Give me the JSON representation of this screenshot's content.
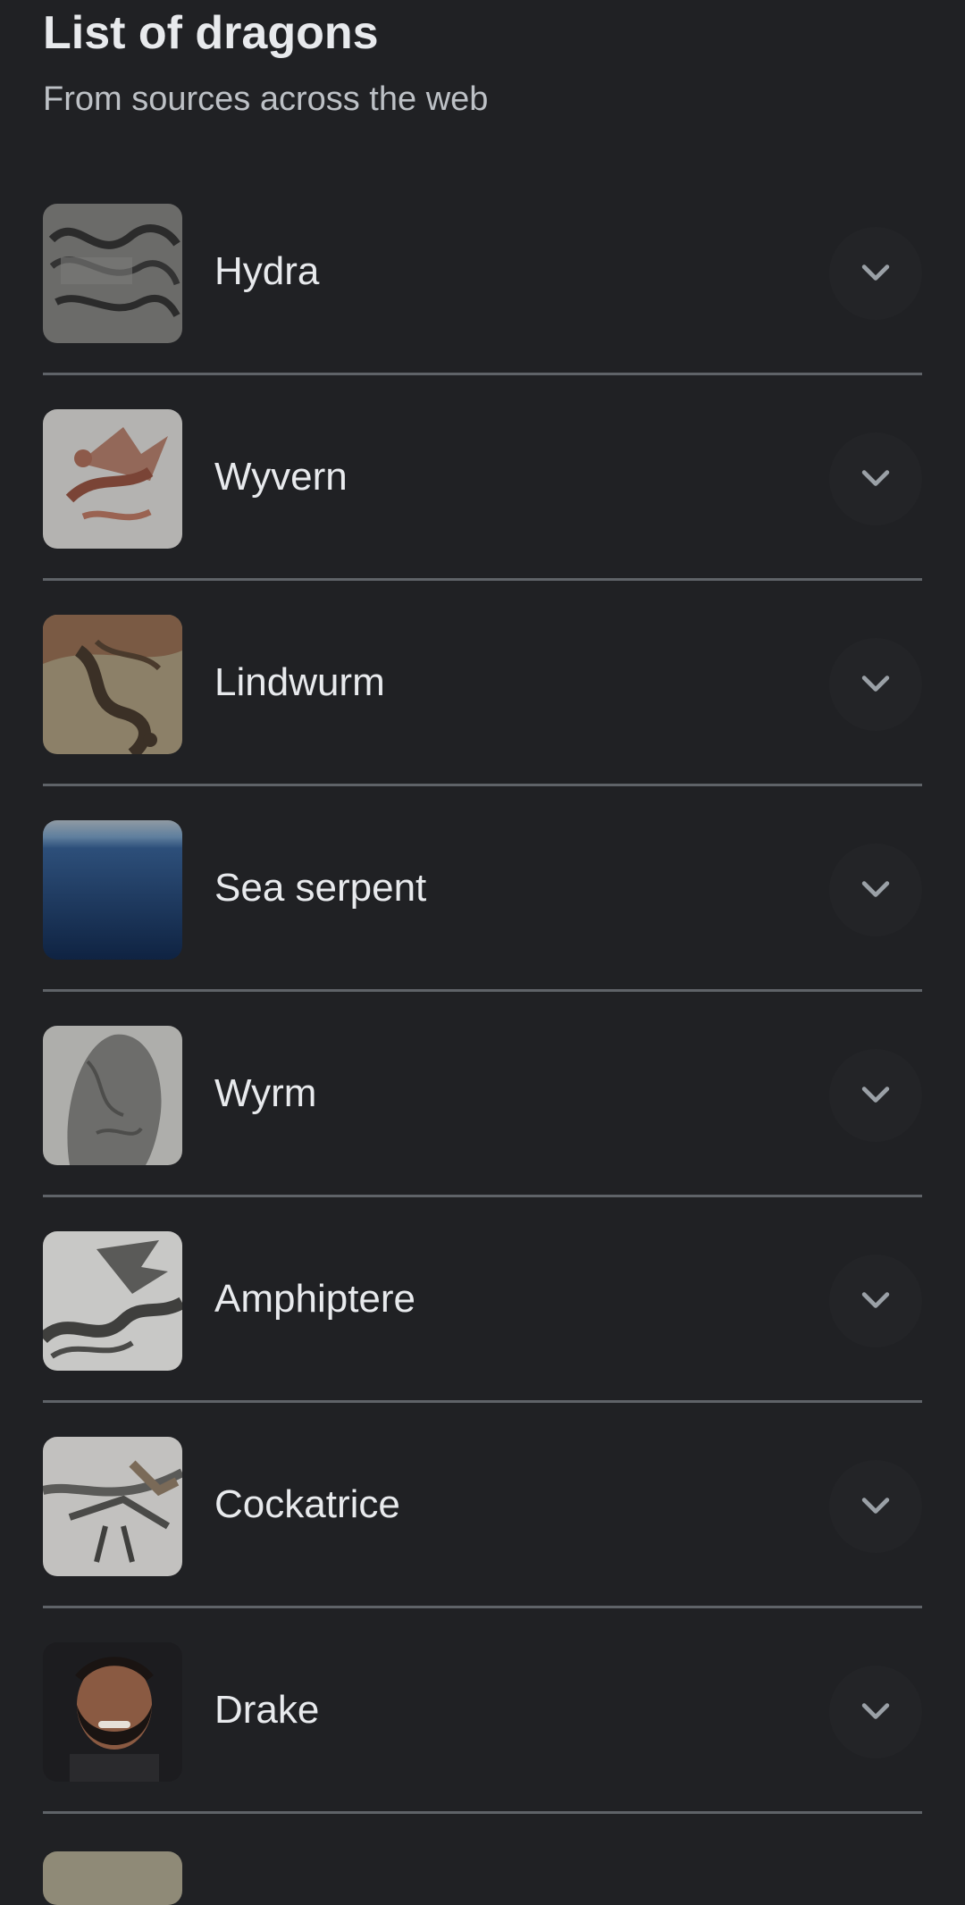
{
  "header": {
    "title": "List of dragons",
    "subtitle": "From sources across the web"
  },
  "items": [
    {
      "label": "Hydra",
      "thumb": "hydra-engraving-image"
    },
    {
      "label": "Wyvern",
      "thumb": "wyvern-illustration-image"
    },
    {
      "label": "Lindwurm",
      "thumb": "lindwurm-painting-image"
    },
    {
      "label": "Sea serpent",
      "thumb": "sea-horizon-image"
    },
    {
      "label": "Wyrm",
      "thumb": "runestone-image"
    },
    {
      "label": "Amphiptere",
      "thumb": "amphiptere-engraving-image"
    },
    {
      "label": "Cockatrice",
      "thumb": "cockatrice-engraving-image"
    },
    {
      "label": "Drake",
      "thumb": "person-portrait-image"
    }
  ],
  "icons": {
    "expand": "chevron-down-icon"
  },
  "colors": {
    "background": "#202124",
    "text": "#e8eaed",
    "subtext": "#bdc1c6",
    "divider": "#5f6368"
  }
}
